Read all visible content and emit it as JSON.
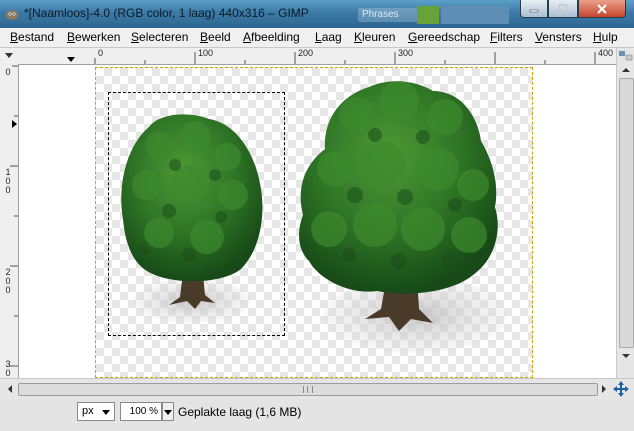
{
  "window": {
    "title": "*[Naamloos]-4.0 (RGB color, 1 laag) 440x316 – GIMP",
    "background_search_text": "Phrases",
    "colors": {
      "titlebar": "#3c7aa6",
      "close_button": "#c7452b"
    }
  },
  "menu": {
    "items": [
      "Bestand",
      "Bewerken",
      "Selecteren",
      "Beeld",
      "Afbeelding",
      "Laag",
      "Kleuren",
      "Gereedschap",
      "Filters",
      "Vensters",
      "Hulp"
    ]
  },
  "rulers": {
    "horizontal": [
      "0",
      "100",
      "200",
      "300",
      "400"
    ],
    "vertical": [
      "0",
      "100",
      "200",
      "300"
    ]
  },
  "canvas": {
    "image_size": "440x316",
    "selection": "dashed rectangle around left tree",
    "layer_boundary_color": "#c8a800",
    "objects": [
      "small-tree",
      "large-tree"
    ]
  },
  "status": {
    "unit": "px",
    "zoom": "100 %",
    "message": "Geplakte laag (1,6 MB)"
  },
  "icons": [
    "gimp-app-icon",
    "minimize-icon",
    "maximize-icon",
    "close-icon",
    "menu-arrow-icon",
    "navigate-icon",
    "move-icon",
    "scroll-up-icon",
    "scroll-down-icon",
    "scroll-left-icon",
    "scroll-right-icon"
  ]
}
